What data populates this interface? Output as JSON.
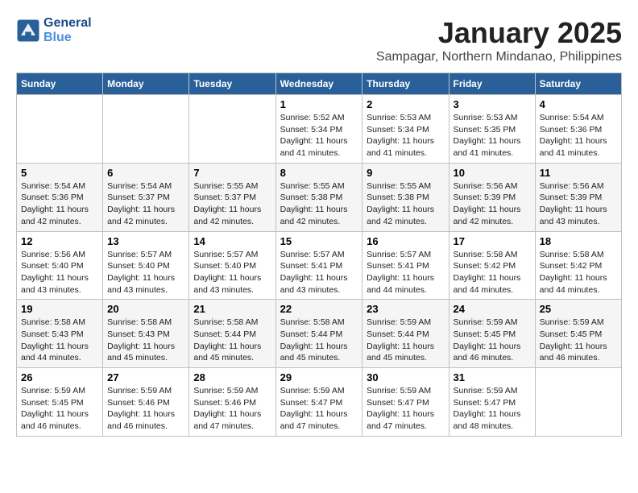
{
  "logo": {
    "line1": "General",
    "line2": "Blue"
  },
  "title": "January 2025",
  "location": "Sampagar, Northern Mindanao, Philippines",
  "weekdays": [
    "Sunday",
    "Monday",
    "Tuesday",
    "Wednesday",
    "Thursday",
    "Friday",
    "Saturday"
  ],
  "weeks": [
    [
      {
        "day": "",
        "sunrise": "",
        "sunset": "",
        "daylight": ""
      },
      {
        "day": "",
        "sunrise": "",
        "sunset": "",
        "daylight": ""
      },
      {
        "day": "",
        "sunrise": "",
        "sunset": "",
        "daylight": ""
      },
      {
        "day": "1",
        "sunrise": "Sunrise: 5:52 AM",
        "sunset": "Sunset: 5:34 PM",
        "daylight": "Daylight: 11 hours and 41 minutes."
      },
      {
        "day": "2",
        "sunrise": "Sunrise: 5:53 AM",
        "sunset": "Sunset: 5:34 PM",
        "daylight": "Daylight: 11 hours and 41 minutes."
      },
      {
        "day": "3",
        "sunrise": "Sunrise: 5:53 AM",
        "sunset": "Sunset: 5:35 PM",
        "daylight": "Daylight: 11 hours and 41 minutes."
      },
      {
        "day": "4",
        "sunrise": "Sunrise: 5:54 AM",
        "sunset": "Sunset: 5:36 PM",
        "daylight": "Daylight: 11 hours and 41 minutes."
      }
    ],
    [
      {
        "day": "5",
        "sunrise": "Sunrise: 5:54 AM",
        "sunset": "Sunset: 5:36 PM",
        "daylight": "Daylight: 11 hours and 42 minutes."
      },
      {
        "day": "6",
        "sunrise": "Sunrise: 5:54 AM",
        "sunset": "Sunset: 5:37 PM",
        "daylight": "Daylight: 11 hours and 42 minutes."
      },
      {
        "day": "7",
        "sunrise": "Sunrise: 5:55 AM",
        "sunset": "Sunset: 5:37 PM",
        "daylight": "Daylight: 11 hours and 42 minutes."
      },
      {
        "day": "8",
        "sunrise": "Sunrise: 5:55 AM",
        "sunset": "Sunset: 5:38 PM",
        "daylight": "Daylight: 11 hours and 42 minutes."
      },
      {
        "day": "9",
        "sunrise": "Sunrise: 5:55 AM",
        "sunset": "Sunset: 5:38 PM",
        "daylight": "Daylight: 11 hours and 42 minutes."
      },
      {
        "day": "10",
        "sunrise": "Sunrise: 5:56 AM",
        "sunset": "Sunset: 5:39 PM",
        "daylight": "Daylight: 11 hours and 42 minutes."
      },
      {
        "day": "11",
        "sunrise": "Sunrise: 5:56 AM",
        "sunset": "Sunset: 5:39 PM",
        "daylight": "Daylight: 11 hours and 43 minutes."
      }
    ],
    [
      {
        "day": "12",
        "sunrise": "Sunrise: 5:56 AM",
        "sunset": "Sunset: 5:40 PM",
        "daylight": "Daylight: 11 hours and 43 minutes."
      },
      {
        "day": "13",
        "sunrise": "Sunrise: 5:57 AM",
        "sunset": "Sunset: 5:40 PM",
        "daylight": "Daylight: 11 hours and 43 minutes."
      },
      {
        "day": "14",
        "sunrise": "Sunrise: 5:57 AM",
        "sunset": "Sunset: 5:40 PM",
        "daylight": "Daylight: 11 hours and 43 minutes."
      },
      {
        "day": "15",
        "sunrise": "Sunrise: 5:57 AM",
        "sunset": "Sunset: 5:41 PM",
        "daylight": "Daylight: 11 hours and 43 minutes."
      },
      {
        "day": "16",
        "sunrise": "Sunrise: 5:57 AM",
        "sunset": "Sunset: 5:41 PM",
        "daylight": "Daylight: 11 hours and 44 minutes."
      },
      {
        "day": "17",
        "sunrise": "Sunrise: 5:58 AM",
        "sunset": "Sunset: 5:42 PM",
        "daylight": "Daylight: 11 hours and 44 minutes."
      },
      {
        "day": "18",
        "sunrise": "Sunrise: 5:58 AM",
        "sunset": "Sunset: 5:42 PM",
        "daylight": "Daylight: 11 hours and 44 minutes."
      }
    ],
    [
      {
        "day": "19",
        "sunrise": "Sunrise: 5:58 AM",
        "sunset": "Sunset: 5:43 PM",
        "daylight": "Daylight: 11 hours and 44 minutes."
      },
      {
        "day": "20",
        "sunrise": "Sunrise: 5:58 AM",
        "sunset": "Sunset: 5:43 PM",
        "daylight": "Daylight: 11 hours and 45 minutes."
      },
      {
        "day": "21",
        "sunrise": "Sunrise: 5:58 AM",
        "sunset": "Sunset: 5:44 PM",
        "daylight": "Daylight: 11 hours and 45 minutes."
      },
      {
        "day": "22",
        "sunrise": "Sunrise: 5:58 AM",
        "sunset": "Sunset: 5:44 PM",
        "daylight": "Daylight: 11 hours and 45 minutes."
      },
      {
        "day": "23",
        "sunrise": "Sunrise: 5:59 AM",
        "sunset": "Sunset: 5:44 PM",
        "daylight": "Daylight: 11 hours and 45 minutes."
      },
      {
        "day": "24",
        "sunrise": "Sunrise: 5:59 AM",
        "sunset": "Sunset: 5:45 PM",
        "daylight": "Daylight: 11 hours and 46 minutes."
      },
      {
        "day": "25",
        "sunrise": "Sunrise: 5:59 AM",
        "sunset": "Sunset: 5:45 PM",
        "daylight": "Daylight: 11 hours and 46 minutes."
      }
    ],
    [
      {
        "day": "26",
        "sunrise": "Sunrise: 5:59 AM",
        "sunset": "Sunset: 5:45 PM",
        "daylight": "Daylight: 11 hours and 46 minutes."
      },
      {
        "day": "27",
        "sunrise": "Sunrise: 5:59 AM",
        "sunset": "Sunset: 5:46 PM",
        "daylight": "Daylight: 11 hours and 46 minutes."
      },
      {
        "day": "28",
        "sunrise": "Sunrise: 5:59 AM",
        "sunset": "Sunset: 5:46 PM",
        "daylight": "Daylight: 11 hours and 47 minutes."
      },
      {
        "day": "29",
        "sunrise": "Sunrise: 5:59 AM",
        "sunset": "Sunset: 5:47 PM",
        "daylight": "Daylight: 11 hours and 47 minutes."
      },
      {
        "day": "30",
        "sunrise": "Sunrise: 5:59 AM",
        "sunset": "Sunset: 5:47 PM",
        "daylight": "Daylight: 11 hours and 47 minutes."
      },
      {
        "day": "31",
        "sunrise": "Sunrise: 5:59 AM",
        "sunset": "Sunset: 5:47 PM",
        "daylight": "Daylight: 11 hours and 48 minutes."
      },
      {
        "day": "",
        "sunrise": "",
        "sunset": "",
        "daylight": ""
      }
    ]
  ]
}
